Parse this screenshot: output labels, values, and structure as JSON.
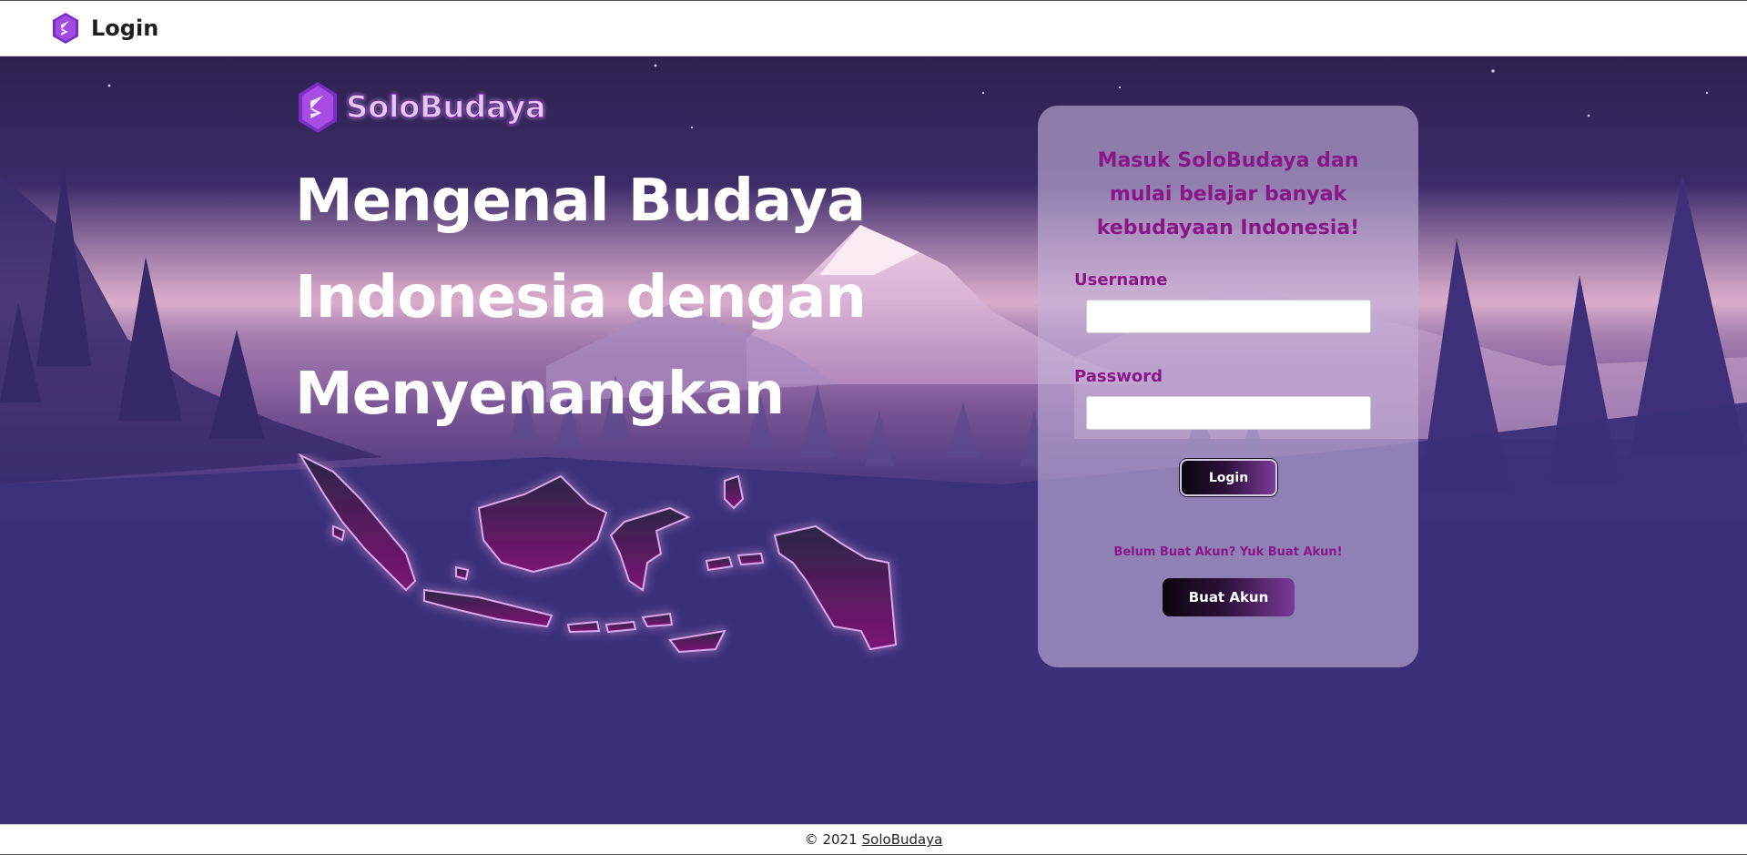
{
  "topbar": {
    "title": "Login",
    "logo_icon": "solobudaya-logo-icon"
  },
  "hero": {
    "brand_name": "SoloBudaya",
    "headline": [
      "Mengenal Budaya",
      "Indonesia dengan",
      "Menyenangkan"
    ],
    "map_icon": "indonesia-map-icon"
  },
  "card": {
    "title": "Masuk SoloBudaya dan mulai belajar banyak kebudayaan Indonesia!",
    "username_label": "Username",
    "username_value": "",
    "password_label": "Password",
    "password_value": "",
    "login_button": "Login",
    "signup_prompt": "Belum Buat Akun? Yuk Buat Akun!",
    "signup_button": "Buat Akun"
  },
  "footer": {
    "copyright": "© 2021",
    "link": "SoloBudaya"
  },
  "colors": {
    "accent": "#8a1688",
    "card_bg": "#c4b2da",
    "hero_dark": "#2e2150",
    "hero_mid": "#3b2f78",
    "map_fill": "#6a1668"
  }
}
